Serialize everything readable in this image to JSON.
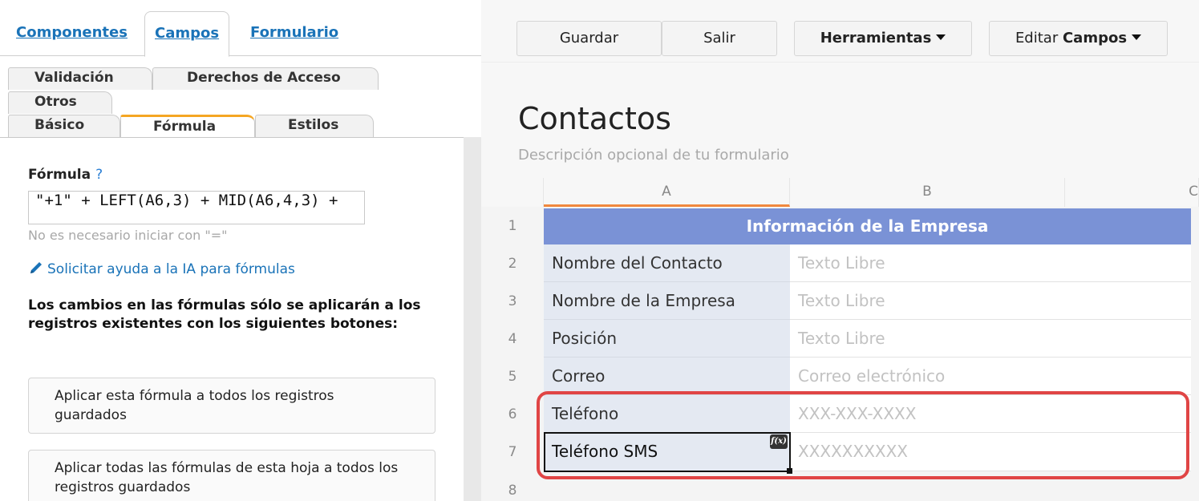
{
  "top_tabs": [
    {
      "label": "Componentes",
      "active": false
    },
    {
      "label": "Campos",
      "active": true
    },
    {
      "label": "Formulario",
      "active": false
    }
  ],
  "sub_tabs": {
    "row1": [
      "Validación",
      "Derechos de Acceso"
    ],
    "row2": [
      "Otros"
    ],
    "row3": [
      "Básico",
      "Fórmula",
      "Estilos"
    ],
    "active": "Fórmula"
  },
  "formula": {
    "label": "Fórmula",
    "help": "?",
    "value": "\"+1\" + LEFT(A6,3) + MID(A6,4,3) +",
    "hint": "No es necesario iniciar con \"=\"",
    "ai_link": "Solicitar ayuda a la IA para fórmulas",
    "notice": "Los cambios en las fórmulas sólo se aplicarán a los registros existentes con los siguientes botones:",
    "apply_one": "Aplicar esta fórmula a todos los registros guardados",
    "apply_all": "Aplicar todas las fórmulas de esta hoja a todos los registros guardados"
  },
  "toolbar": {
    "save": "Guardar",
    "exit": "Salir",
    "tools": "Herramientas",
    "edit_prefix": "Editar",
    "edit_mode": "Campos"
  },
  "sheet": {
    "title": "Contactos",
    "description": "Descripción opcional de tu formulario",
    "columns": [
      "A",
      "B",
      "C"
    ],
    "header_row": {
      "num": "1",
      "text": "Información de la Empresa"
    },
    "rows": [
      {
        "num": "2",
        "label": "Nombre del Contacto",
        "placeholder": "Texto Libre"
      },
      {
        "num": "3",
        "label": "Nombre de la Empresa",
        "placeholder": "Texto Libre"
      },
      {
        "num": "4",
        "label": "Posición",
        "placeholder": "Texto Libre"
      },
      {
        "num": "5",
        "label": "Correo",
        "placeholder": "Correo electrónico"
      },
      {
        "num": "6",
        "label": "Teléfono",
        "placeholder": "XXX-XXX-XXXX"
      },
      {
        "num": "7",
        "label": "Teléfono SMS",
        "placeholder": "XXXXXXXXXX"
      }
    ],
    "empty_row_num": "8",
    "fx_badge": "f(x)"
  },
  "colors": {
    "link": "#1a73b8",
    "active_tab_accent": "#f5a623",
    "header_row_bg": "#7a92d6",
    "highlight": "#e04545"
  }
}
